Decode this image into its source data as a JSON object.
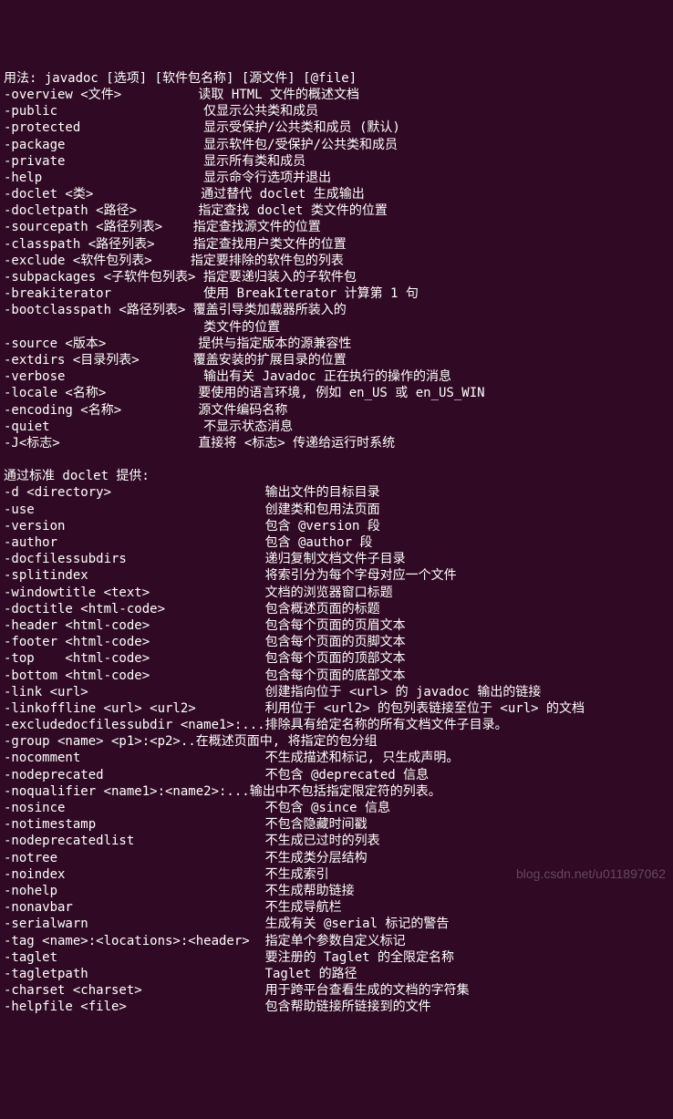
{
  "lines": [
    "用法: javadoc [选项] [软件包名称] [源文件] [@file]",
    "-overview <文件>          读取 HTML 文件的概述文档",
    "-public                   仅显示公共类和成员",
    "-protected                显示受保护/公共类和成员 (默认)",
    "-package                  显示软件包/受保护/公共类和成员",
    "-private                  显示所有类和成员",
    "-help                     显示命令行选项并退出",
    "-doclet <类>              通过替代 doclet 生成输出",
    "-docletpath <路径>        指定查找 doclet 类文件的位置",
    "-sourcepath <路径列表>    指定查找源文件的位置",
    "-classpath <路径列表>     指定查找用户类文件的位置",
    "-exclude <软件包列表>     指定要排除的软件包的列表",
    "-subpackages <子软件包列表> 指定要递归装入的子软件包",
    "-breakiterator            使用 BreakIterator 计算第 1 句",
    "-bootclasspath <路径列表> 覆盖引导类加载器所装入的",
    "                          类文件的位置",
    "-source <版本>            提供与指定版本的源兼容性",
    "-extdirs <目录列表>       覆盖安装的扩展目录的位置",
    "-verbose                  输出有关 Javadoc 正在执行的操作的消息",
    "-locale <名称>            要使用的语言环境, 例如 en_US 或 en_US_WIN",
    "-encoding <名称>          源文件编码名称",
    "-quiet                    不显示状态消息",
    "-J<标志>                  直接将 <标志> 传递给运行时系统",
    "",
    "通过标准 doclet 提供:",
    "-d <directory>                    输出文件的目标目录",
    "-use                              创建类和包用法页面",
    "-version                          包含 @version 段",
    "-author                           包含 @author 段",
    "-docfilessubdirs                  递归复制文档文件子目录",
    "-splitindex                       将索引分为每个字母对应一个文件",
    "-windowtitle <text>               文档的浏览器窗口标题",
    "-doctitle <html-code>             包含概述页面的标题",
    "-header <html-code>               包含每个页面的页眉文本",
    "-footer <html-code>               包含每个页面的页脚文本",
    "-top    <html-code>               包含每个页面的顶部文本",
    "-bottom <html-code>               包含每个页面的底部文本",
    "-link <url>                       创建指向位于 <url> 的 javadoc 输出的链接",
    "-linkoffline <url> <url2>         利用位于 <url2> 的包列表链接至位于 <url> 的文档",
    "-excludedocfilessubdir <name1>:...排除具有给定名称的所有文档文件子目录。",
    "-group <name> <p1>:<p2>..在概述页面中, 将指定的包分组",
    "-nocomment                        不生成描述和标记, 只生成声明。",
    "-nodeprecated                     不包含 @deprecated 信息",
    "-noqualifier <name1>:<name2>:...输出中不包括指定限定符的列表。",
    "-nosince                          不包含 @since 信息",
    "-notimestamp                      不包含隐藏时间戳",
    "-nodeprecatedlist                 不生成已过时的列表",
    "-notree                           不生成类分层结构",
    "-noindex                          不生成索引",
    "-nohelp                           不生成帮助链接",
    "-nonavbar                         不生成导航栏",
    "-serialwarn                       生成有关 @serial 标记的警告",
    "-tag <name>:<locations>:<header>  指定单个参数自定义标记",
    "-taglet                           要注册的 Taglet 的全限定名称",
    "-tagletpath                       Taglet 的路径",
    "-charset <charset>                用于跨平台查看生成的文档的字符集",
    "-helpfile <file>                  包含帮助链接所链接到的文件"
  ],
  "watermark": "blog.csdn.net/u011897062"
}
